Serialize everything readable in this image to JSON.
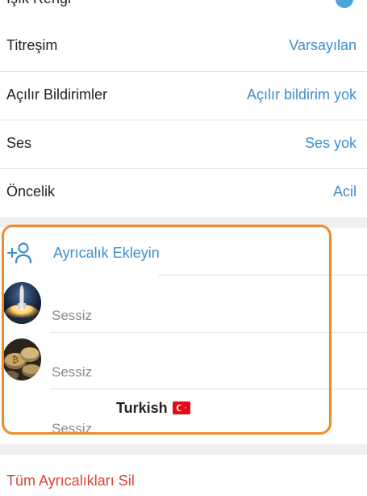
{
  "settings": {
    "light_color_label": "Işık Rengi",
    "vibration_label": "Titreşim",
    "vibration_value": "Varsayılan",
    "popup_label": "Açılır Bildirimler",
    "popup_value": "Açılır bildirim yok",
    "sound_label": "Ses",
    "sound_value": "Ses yok",
    "priority_label": "Öncelik",
    "priority_value": "Acil"
  },
  "exceptions": {
    "add_label": "Ayrıcalık Ekleyin",
    "items": [
      {
        "name": "",
        "status": "Sessiz",
        "avatar_icon": "rocket-launch-photo"
      },
      {
        "name": "",
        "status": "Sessiz",
        "avatar_icon": "bitcoin-coins-photo"
      },
      {
        "name": "Turkish",
        "status": "Sessiz",
        "avatar_icon": "none",
        "flag_icon": "turkey-flag-icon"
      }
    ]
  },
  "delete_all_label": "Tüm Ayrıcalıkları Sil",
  "colors": {
    "accent": "#3d8fcc",
    "highlight_border": "#f08a2c",
    "danger": "#d9453c",
    "muted_text": "#8a8a8a",
    "divider": "#e2e2e2",
    "section_band": "#efefef"
  }
}
